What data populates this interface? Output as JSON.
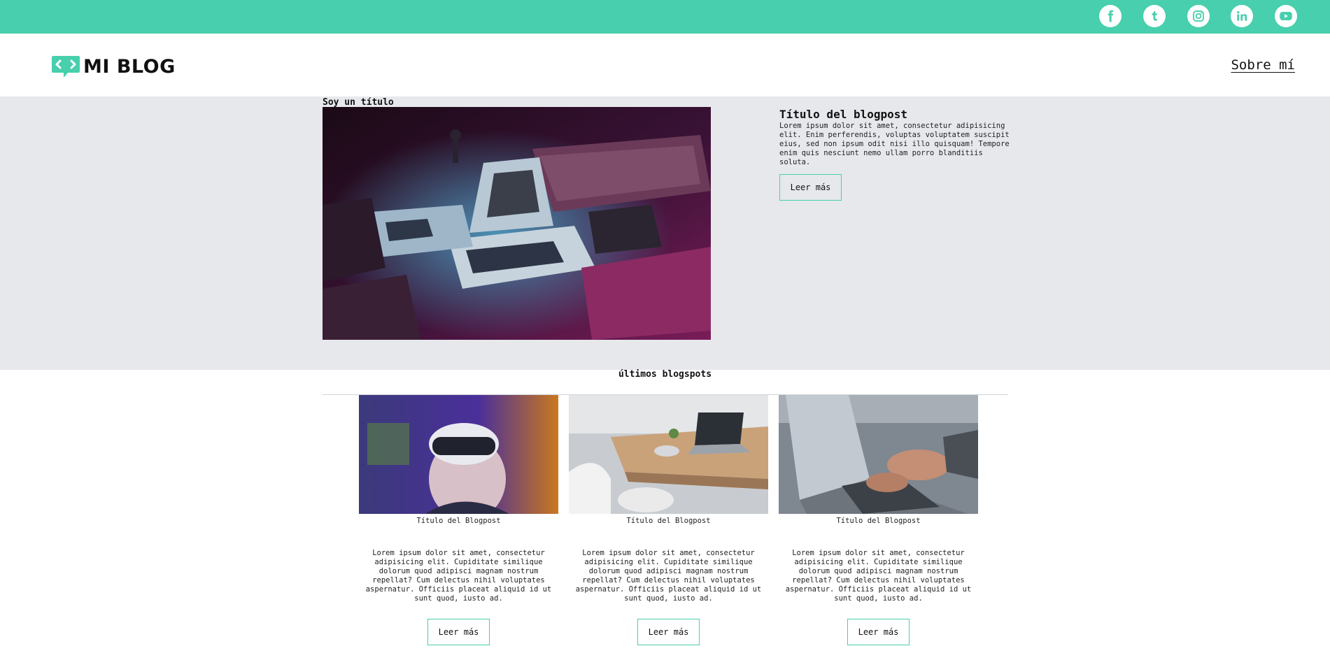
{
  "topbar": {
    "background": "#48cfad",
    "social": [
      {
        "name": "facebook-icon"
      },
      {
        "name": "tumblr-icon"
      },
      {
        "name": "instagram-icon"
      },
      {
        "name": "linkedin-icon"
      },
      {
        "name": "youtube-icon"
      }
    ]
  },
  "header": {
    "logo_text": "MI BLOG",
    "about_link": "Sobre mí"
  },
  "hero": {
    "label": "Soy un título",
    "post_title": "Título del blogpost",
    "post_text": "Lorem ipsum dolor sit amet, consectetur adipisicing elit. Enim perferendis, voluptas voluptatem suscipit eius, sed non ipsum odit nisi illo quisquam! Tempore enim quis nesciunt nemo ullam porro blanditiis soluta.",
    "button_label": "Leer más"
  },
  "latest": {
    "section_title": "últimos blogspots",
    "cards": [
      {
        "title": "Título del Blogpost",
        "text": "Lorem ipsum dolor sit amet, consectetur adipisicing elit. Cupiditate similique dolorum quod adipisci magnam nostrum repellat? Cum delectus nihil voluptates aspernatur. Officiis placeat aliquid id ut sunt quod, iusto ad.",
        "button_label": "Leer más"
      },
      {
        "title": "Título del Blogpost",
        "text": "Lorem ipsum dolor sit amet, consectetur adipisicing elit. Cupiditate similique dolorum quod adipisci magnam nostrum repellat? Cum delectus nihil voluptates aspernatur. Officiis placeat aliquid id ut sunt quod, iusto ad.",
        "button_label": "Leer más"
      },
      {
        "title": "Título del Blogpost",
        "text": "Lorem ipsum dolor sit amet, consectetur adipisicing elit. Cupiditate similique dolorum quod adipisci magnam nostrum repellat? Cum delectus nihil voluptates aspernatur. Officiis placeat aliquid id ut sunt quod, iusto ad.",
        "button_label": "Leer más"
      }
    ]
  },
  "colors": {
    "accent": "#48cfad",
    "hero_background": "#e6e8ec"
  }
}
